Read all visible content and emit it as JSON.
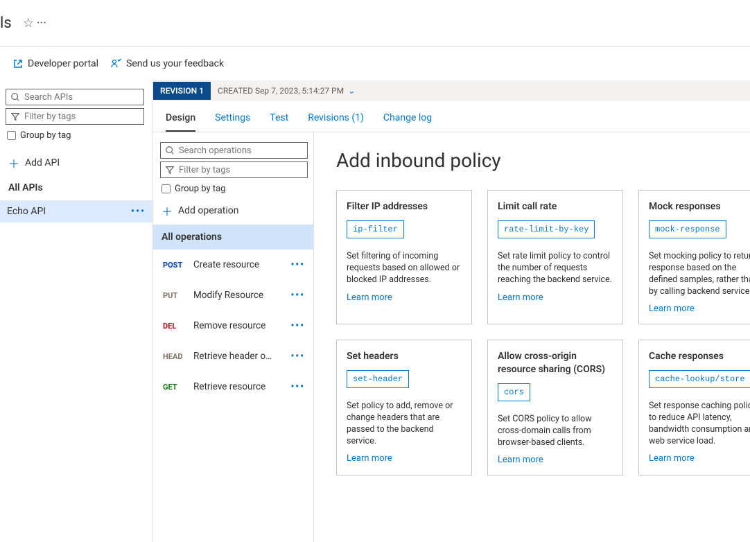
{
  "top": {
    "fragment": "ls",
    "star": "☆",
    "more": "···"
  },
  "header_links": {
    "devportal": "Developer portal",
    "feedback": "Send us your feedback"
  },
  "left": {
    "search_placeholder": "Search APIs",
    "filter_placeholder": "Filter by tags",
    "group_by_tag": "Group by tag",
    "add_api": "Add API",
    "all_apis": "All APIs",
    "selected_api": "Echo API"
  },
  "revision": {
    "badge": "REVISION 1",
    "created": "CREATED Sep 7, 2023, 5:14:27 PM"
  },
  "tabs": {
    "design": "Design",
    "settings": "Settings",
    "test": "Test",
    "revisions": "Revisions (1)",
    "changelog": "Change log"
  },
  "ops": {
    "search_placeholder": "Search operations",
    "filter_placeholder": "Filter by tags",
    "group_by_tag": "Group by tag",
    "add_operation": "Add operation",
    "all_operations": "All operations",
    "list": [
      {
        "verb": "POST",
        "verb_class": "post",
        "name": "Create resource"
      },
      {
        "verb": "PUT",
        "verb_class": "put",
        "name": "Modify Resource"
      },
      {
        "verb": "DEL",
        "verb_class": "del",
        "name": "Remove resource"
      },
      {
        "verb": "HEAD",
        "verb_class": "head",
        "name": "Retrieve header o…"
      },
      {
        "verb": "GET",
        "verb_class": "get",
        "name": "Retrieve resource"
      }
    ]
  },
  "policy": {
    "title": "Add inbound policy",
    "learn_more": "Learn more",
    "cards": [
      {
        "title": "Filter IP addresses",
        "code": "ip-filter",
        "desc": "Set filtering of incoming requests based on allowed or blocked IP addresses."
      },
      {
        "title": "Limit call rate",
        "code": "rate-limit-by-key",
        "desc": "Set rate limit policy to control the number of requests reaching the backend service."
      },
      {
        "title": "Mock responses",
        "code": "mock-response",
        "desc": "Set mocking policy to return a response based on the defined samples, rather than by calling backend service."
      },
      {
        "title": "Set headers",
        "code": "set-header",
        "desc": "Set policy to add, remove or change headers that are passed to the backend service."
      },
      {
        "title": "Allow cross-origin resource sharing (CORS)",
        "code": "cors",
        "desc": "Set CORS policy to allow cross-domain calls from browser-based clients."
      },
      {
        "title": "Cache responses",
        "code": "cache-lookup/store",
        "desc": "Set response caching policies to reduce API latency, bandwidth consumption and web service load."
      }
    ]
  }
}
